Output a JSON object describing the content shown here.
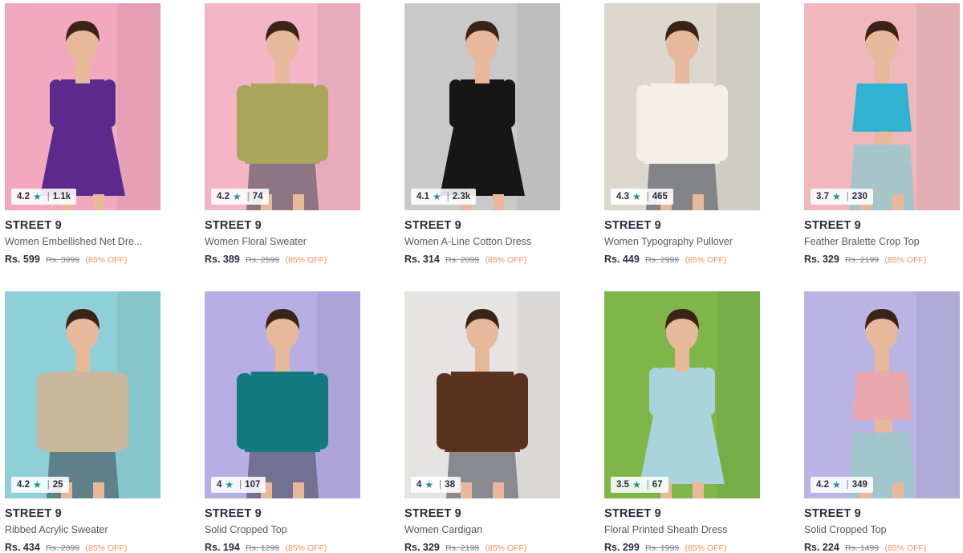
{
  "products": [
    {
      "brand": "STREET 9",
      "title": "Women Embellished Net Dre...",
      "price": "Rs. 599",
      "mrp": "Rs. 3999",
      "discount": "(85% OFF)",
      "rating": "4.2",
      "count": "1.1k",
      "bg": "#f2a9c0",
      "garment": "#5b2a8c",
      "garment_type": "dress"
    },
    {
      "brand": "STREET 9",
      "title": "Women Floral Sweater",
      "price": "Rs. 389",
      "mrp": "Rs. 2599",
      "discount": "(85% OFF)",
      "rating": "4.2",
      "count": "74",
      "bg": "#f4b6c6",
      "garment": "#a9a55c",
      "garment_type": "top"
    },
    {
      "brand": "STREET 9",
      "title": "Women A-Line Cotton Dress",
      "price": "Rs. 314",
      "mrp": "Rs. 2099",
      "discount": "(85% OFF)",
      "rating": "4.1",
      "count": "2.3k",
      "bg": "#c9c9c9",
      "garment": "#161616",
      "garment_type": "dress"
    },
    {
      "brand": "STREET 9",
      "title": "Women Typography Pullover",
      "price": "Rs. 449",
      "mrp": "Rs. 2999",
      "discount": "(85% OFF)",
      "rating": "4.3",
      "count": "465",
      "bg": "#dcd8cf",
      "garment": "#f4efe8",
      "garment_type": "top"
    },
    {
      "brand": "STREET 9",
      "title": "Feather Bralette Crop Top",
      "price": "Rs. 329",
      "mrp": "Rs. 2199",
      "discount": "(85% OFF)",
      "rating": "3.7",
      "count": "230",
      "bg": "#f0b7bd",
      "garment": "#2fb3d1",
      "garment_type": "crop"
    },
    {
      "brand": "STREET 9",
      "title": "Ribbed Acrylic Sweater",
      "price": "Rs. 434",
      "mrp": "Rs. 2899",
      "discount": "(85% OFF)",
      "rating": "4.2",
      "count": "25",
      "bg": "#8fd0d8",
      "garment": "#cbb79c",
      "garment_type": "top"
    },
    {
      "brand": "STREET 9",
      "title": "Solid Cropped Top",
      "price": "Rs. 194",
      "mrp": "Rs. 1299",
      "discount": "(85% OFF)",
      "rating": "4",
      "count": "107",
      "bg": "#b7aee6",
      "garment": "#117a7e",
      "garment_type": "top"
    },
    {
      "brand": "STREET 9",
      "title": "Women Cardigan",
      "price": "Rs. 329",
      "mrp": "Rs. 2199",
      "discount": "(85% OFF)",
      "rating": "4",
      "count": "38",
      "bg": "#e6e4e2",
      "garment": "#5a3320",
      "garment_type": "top"
    },
    {
      "brand": "STREET 9",
      "title": "Floral Printed Sheath Dress",
      "price": "Rs. 299",
      "mrp": "Rs. 1999",
      "discount": "(85% OFF)",
      "rating": "3.5",
      "count": "67",
      "bg": "#7fb64a",
      "garment": "#a9d3dd",
      "garment_type": "dress"
    },
    {
      "brand": "STREET 9",
      "title": "Solid Cropped Top",
      "price": "Rs. 224",
      "mrp": "Rs. 1499",
      "discount": "(85% OFF)",
      "rating": "4.2",
      "count": "349",
      "bg": "#b9b4e4",
      "garment": "#e9a8ad",
      "garment_type": "crop"
    }
  ],
  "colors": {
    "star": "#14958f",
    "discount": "#ff905a",
    "skin": "#e7b89a",
    "hair": "#3a2418"
  }
}
